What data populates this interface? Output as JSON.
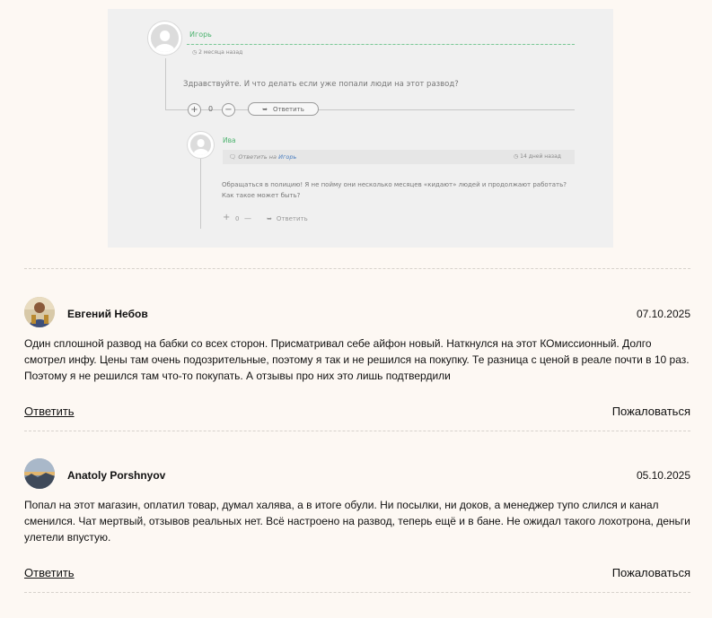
{
  "thread": {
    "top": {
      "author": "Игорь",
      "time": "2 месяца назад",
      "text": "Здравствуйте. И что делать если уже попали люди на этот развод?",
      "plus": "+",
      "votes": "0",
      "minus": "−",
      "reply_label": "Ответить",
      "time_icon": "clock-icon",
      "reply_icon": "reply-arrow-icon"
    },
    "reply": {
      "author": "Ива",
      "reply_to_prefix": "Ответить на",
      "reply_to_name": "Игорь",
      "time": "14 дней назад",
      "text": "Обращаться в полицию! Я не пойму они несколько месяцев «кидают» людей и продолжают работать? Как такое может быть?",
      "plus": "+",
      "votes": "0",
      "minus": "—",
      "reply_label": "Ответить",
      "chat_icon": "chat-bubble-icon",
      "time_icon": "clock-icon",
      "reply_icon": "reply-arrow-icon"
    },
    "colors": {
      "name": "#4db36f",
      "background": "#f0f0f0"
    }
  },
  "comments": [
    {
      "author": "Евгений Небов",
      "date": "07.10.2025",
      "text": "Один сплошной развод на бабки со всех сторон. Присматривал себе айфон новый. Наткнулся на этот КОмиссионный. Долго смотрел инфу. Цены там очень подозрительные, поэтому я так и не решился на покупку. Те разница с ценой в реале почти в 10 раз. Поэтому я не решился там что-то покупать. А отзывы про них это лишь подтвердили",
      "reply_label": "Ответить",
      "report_label": "Пожаловаться"
    },
    {
      "author": "Anatoly Porshnyov",
      "date": "05.10.2025",
      "text": "Попал на этот магазин, оплатил товар, думал халява, а в итоге обули. Ни посылки, ни доков, а менеджер тупо слился и канал сменился. Чат мертвый, отзывов реальных нет. Всё настроено на развод, теперь ещё и в бане. Не ожидал такого лохотрона, деньги улетели впустую.",
      "reply_label": "Ответить",
      "report_label": "Пожаловаться"
    }
  ]
}
